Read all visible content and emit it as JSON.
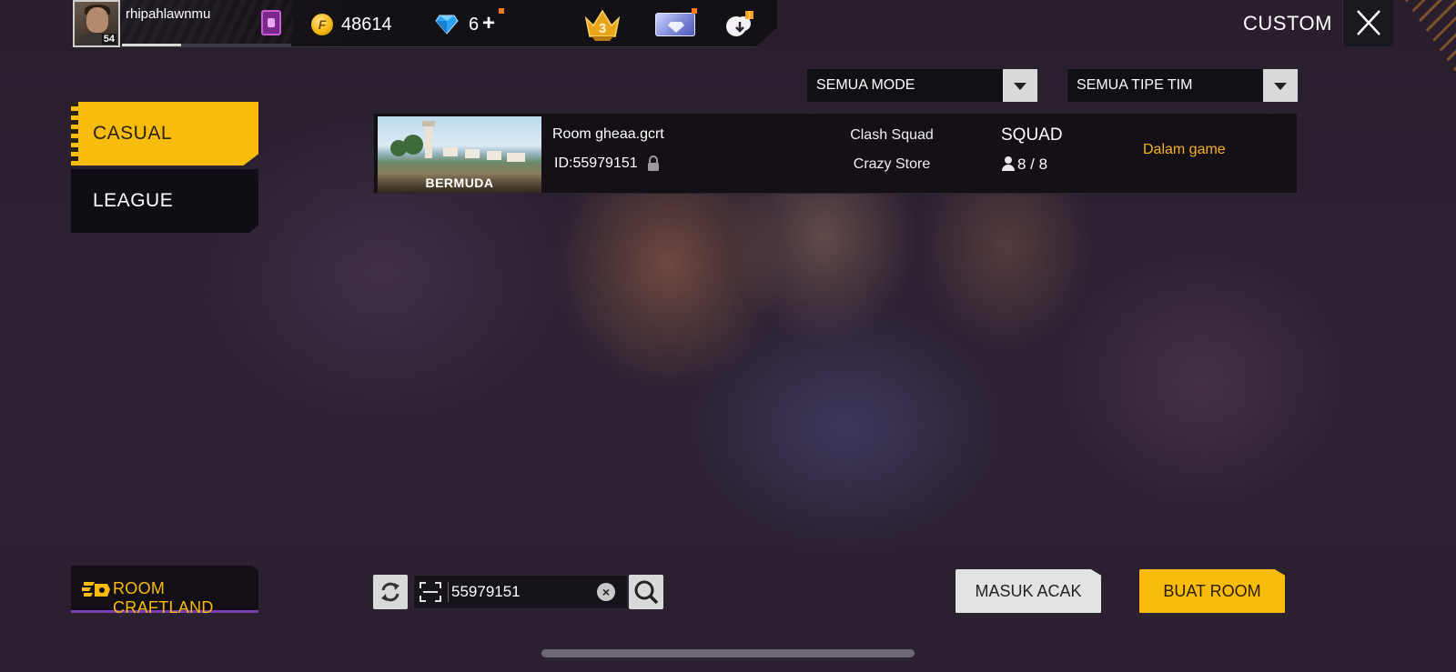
{
  "player": {
    "username": "rhipahlawnmu",
    "level": "54",
    "xp_progress": 0.35
  },
  "currency": {
    "coin_symbol": "F",
    "coins": "48614",
    "diamonds": "6",
    "diamond_add": "+"
  },
  "rank": {
    "value": "3"
  },
  "header": {
    "title": "CUSTOM"
  },
  "filters": {
    "mode": "SEMUA MODE",
    "team_type": "SEMUA TIPE TIM"
  },
  "tabs": [
    {
      "label": "CASUAL",
      "active": true
    },
    {
      "label": "LEAGUE",
      "active": false
    }
  ],
  "rooms": [
    {
      "map": "BERMUDA",
      "name": "Room gheaa.gcrt",
      "id": "ID:55979151",
      "mode": "Clash Squad",
      "map_variant": "Crazy Store",
      "team": "SQUAD",
      "players": "8 / 8",
      "status": "Dalam game",
      "locked": true
    }
  ],
  "bottom": {
    "craftland_label": "ROOM CRAFTLAND",
    "search_value": "55979151",
    "clear_symbol": "×",
    "random_label": "MASUK ACAK",
    "create_label": "BUAT ROOM"
  },
  "colors": {
    "accent": "#f8bd0c",
    "status": "#f6b321",
    "panel": "#141016"
  },
  "icons": {
    "badge": "badge-icon",
    "coin": "coin-icon",
    "diamond": "diamond-icon",
    "rank": "rank-crown-icon",
    "card": "membership-card-icon",
    "gift": "cloud-gift-icon",
    "close": "close-icon",
    "lock": "lock-icon",
    "player": "player-icon",
    "refresh": "refresh-icon",
    "scan": "scan-icon",
    "search": "search-icon",
    "craftland": "craftland-icon"
  }
}
